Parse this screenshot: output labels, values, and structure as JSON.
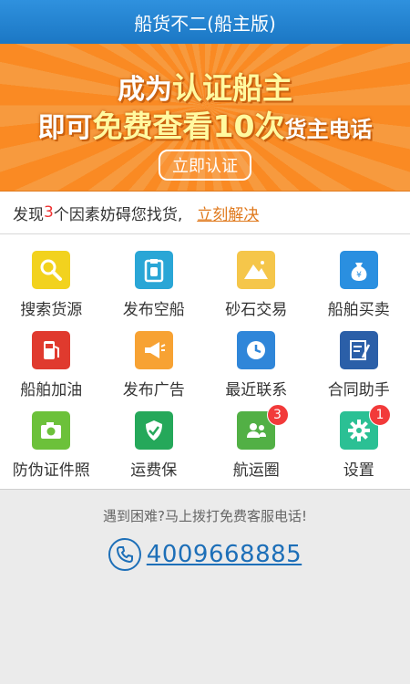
{
  "title": "船货不二(船主版)",
  "banner": {
    "line1_pre": "成为",
    "line1_hl": "认证船主",
    "line2_pre": "即可",
    "line2_hl": "免费查看10次",
    "line2_post": "货主电话",
    "button": "立即认证"
  },
  "notice": {
    "pre": "发现",
    "count": "3",
    "post": "个因素妨碍您找货,",
    "link": "立刻解决"
  },
  "grid": [
    {
      "label": "搜索货源",
      "icon": "search-icon",
      "color": "#f2d21e"
    },
    {
      "label": "发布空船",
      "icon": "clipboard-icon",
      "color": "#2aa6d6"
    },
    {
      "label": "砂石交易",
      "icon": "mountain-icon",
      "color": "#f5c64a"
    },
    {
      "label": "船舶买卖",
      "icon": "money-bag-icon",
      "color": "#2a8fe0"
    },
    {
      "label": "船舶加油",
      "icon": "fuel-pump-icon",
      "color": "#e03a2e"
    },
    {
      "label": "发布广告",
      "icon": "megaphone-icon",
      "color": "#f7a233"
    },
    {
      "label": "最近联系",
      "icon": "clock-icon",
      "color": "#2f86d9"
    },
    {
      "label": "合同助手",
      "icon": "contract-icon",
      "color": "#2b5fa8"
    },
    {
      "label": "防伪证件照",
      "icon": "camera-icon",
      "color": "#6cc13a"
    },
    {
      "label": "运费保",
      "icon": "shield-check-icon",
      "color": "#25a85a"
    },
    {
      "label": "航运圈",
      "icon": "contacts-icon",
      "color": "#52b045",
      "badge": "3"
    },
    {
      "label": "设置",
      "icon": "gear-icon",
      "color": "#2bc094",
      "badge": "1"
    }
  ],
  "footer": {
    "tip": "遇到困难?马上拨打免费客服电话!",
    "phone": "4009668885"
  }
}
